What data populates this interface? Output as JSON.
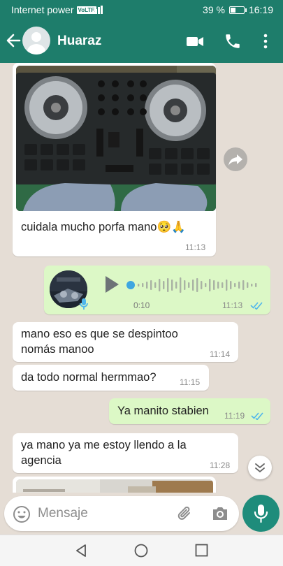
{
  "status_bar": {
    "carrier": "Internet power",
    "network_badge": "VoLTE",
    "battery": "39 %",
    "battery_level": 0.39,
    "time": "16:19"
  },
  "header": {
    "contact_name": "Huaraz",
    "icons": [
      "back-arrow-icon",
      "avatar",
      "video-call-icon",
      "phone-call-icon",
      "more-options-icon"
    ]
  },
  "messages": [
    {
      "type": "image",
      "direction": "in",
      "caption": "cuidala mucho porfa mano🥺🙏",
      "time": "11:13"
    },
    {
      "type": "voice",
      "direction": "out",
      "duration": "0:10",
      "time": "11:13",
      "status": "read"
    },
    {
      "type": "text",
      "direction": "in",
      "text": "mano eso es que se despintoo nomás manoo",
      "time": "11:14"
    },
    {
      "type": "text",
      "direction": "in",
      "text": "da todo normal hermmao?",
      "time": "11:15"
    },
    {
      "type": "text",
      "direction": "out",
      "text": "Ya manito stabien",
      "time": "11:19",
      "status": "read"
    },
    {
      "type": "text",
      "direction": "in",
      "text": "ya mano ya me estoy llendo a la agencia",
      "time": "11:28"
    }
  ],
  "composer": {
    "placeholder": "Mensaje"
  },
  "colors": {
    "header": "#1e7d6b",
    "outgoing_bubble": "#dcf8c6",
    "incoming_bubble": "#ffffff",
    "read_ticks": "#4fb6ec",
    "mic_button": "#1e8c7b",
    "chat_background": "#e5ddd5"
  }
}
